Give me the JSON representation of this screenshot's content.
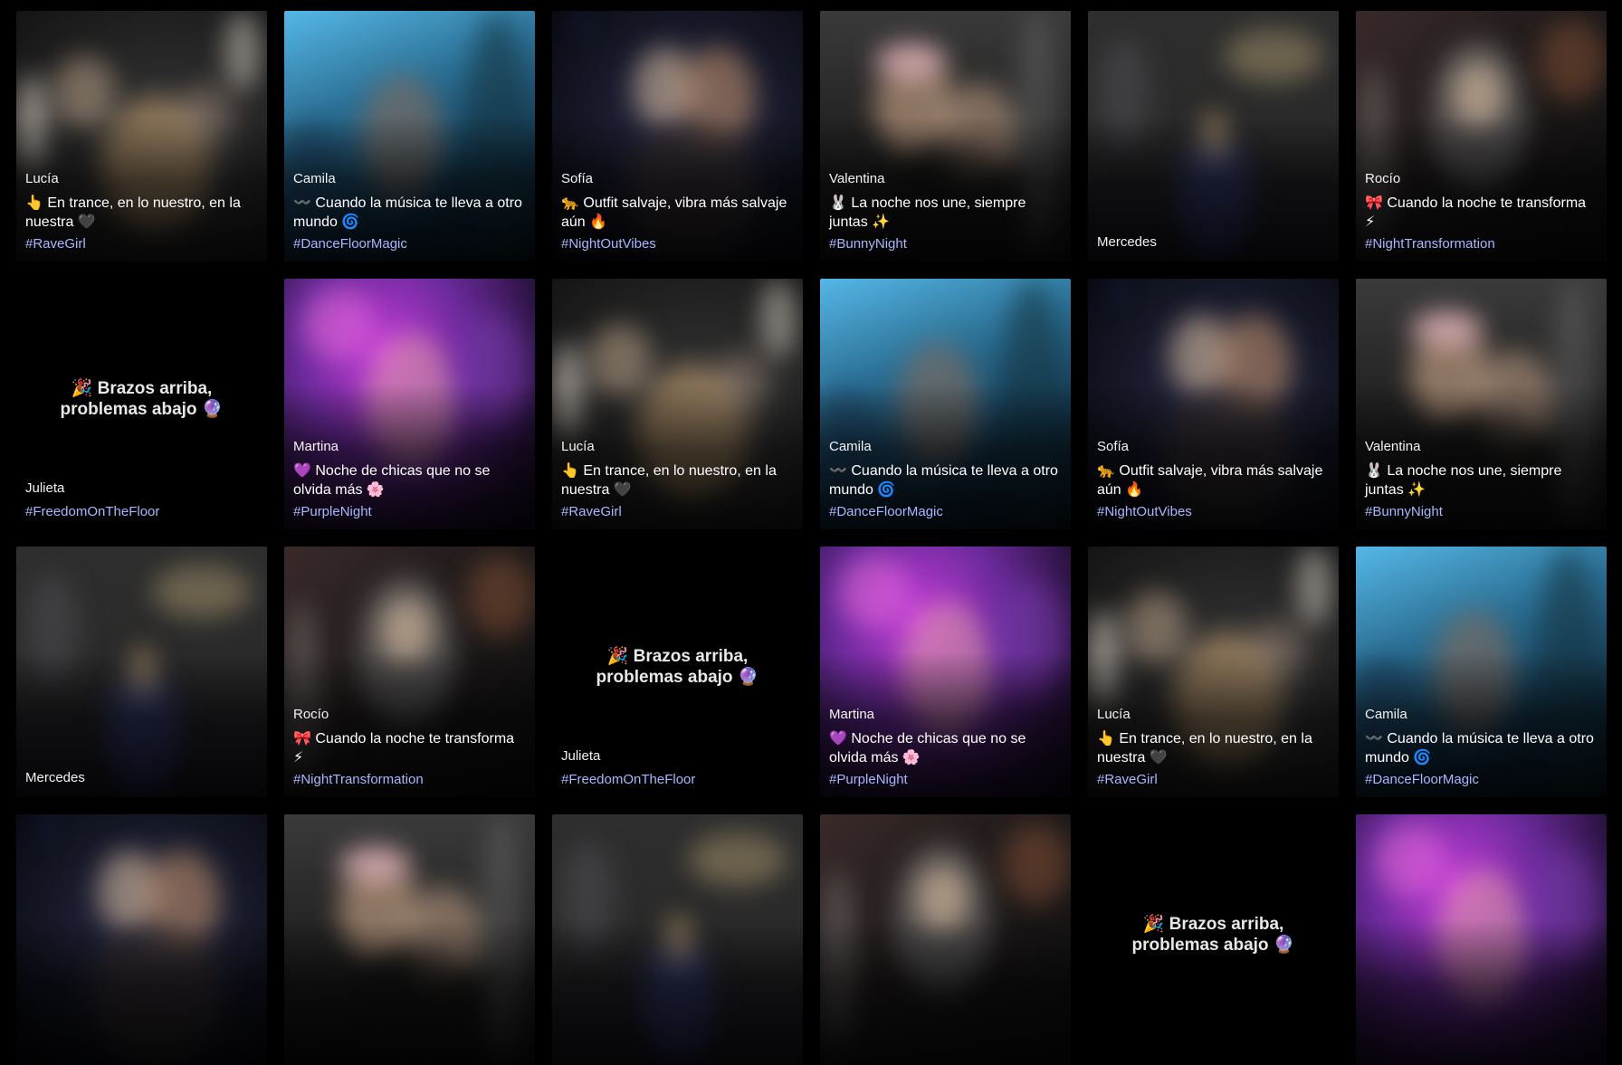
{
  "colors": {
    "background": "#000000",
    "hashtag": "#a9b7ff",
    "text": "#ffffff"
  },
  "cards": [
    {
      "kind": "photo",
      "theme": "crowd",
      "author": "Lucía",
      "caption": "👆 En trance, en lo nuestro, en la nuestra 🖤",
      "tag": "#RaveGirl"
    },
    {
      "kind": "photo",
      "theme": "blue",
      "author": "Camila",
      "caption": "〰️ Cuando la música te lleva a otro mundo 🌀",
      "tag": "#DanceFloorMagic"
    },
    {
      "kind": "photo",
      "theme": "duo",
      "author": "Sofía",
      "caption": "🐆 Outfit salvaje, vibra más salvaje aún 🔥",
      "tag": "#NightOutVibes"
    },
    {
      "kind": "photo",
      "theme": "bunny",
      "author": "Valentina",
      "caption": "🐰 La noche nos une, siempre juntas ✨",
      "tag": "#BunnyNight"
    },
    {
      "kind": "photo",
      "theme": "castle",
      "author": "Mercedes",
      "caption": "",
      "tag": ""
    },
    {
      "kind": "photo",
      "theme": "bar",
      "author": "Rocío",
      "caption": "🎀 Cuando la noche te transforma ⚡",
      "tag": "#NightTransformation"
    },
    {
      "kind": "text",
      "theme": "none",
      "headline": "🎉 Brazos arriba, problemas abajo 🔮",
      "author": "Julieta",
      "caption": "",
      "tag": "#FreedomOnTheFloor"
    },
    {
      "kind": "photo",
      "theme": "purple",
      "author": "Martina",
      "caption": "💜 Noche de chicas que no se olvida más 🌸",
      "tag": "#PurpleNight"
    },
    {
      "kind": "photo",
      "theme": "crowd",
      "author": "Lucía",
      "caption": "👆 En trance, en lo nuestro, en la nuestra 🖤",
      "tag": "#RaveGirl"
    },
    {
      "kind": "photo",
      "theme": "blue",
      "author": "Camila",
      "caption": "〰️ Cuando la música te lleva a otro mundo 🌀",
      "tag": "#DanceFloorMagic"
    },
    {
      "kind": "photo",
      "theme": "duo",
      "author": "Sofía",
      "caption": "🐆 Outfit salvaje, vibra más salvaje aún 🔥",
      "tag": "#NightOutVibes"
    },
    {
      "kind": "photo",
      "theme": "bunny",
      "author": "Valentina",
      "caption": "🐰 La noche nos une, siempre juntas ✨",
      "tag": "#BunnyNight"
    },
    {
      "kind": "photo",
      "theme": "castle",
      "author": "Mercedes",
      "caption": "",
      "tag": ""
    },
    {
      "kind": "photo",
      "theme": "bar",
      "author": "Rocío",
      "caption": "🎀 Cuando la noche te transforma ⚡",
      "tag": "#NightTransformation"
    },
    {
      "kind": "text",
      "theme": "none",
      "headline": "🎉 Brazos arriba, problemas abajo 🔮",
      "author": "Julieta",
      "caption": "",
      "tag": "#FreedomOnTheFloor"
    },
    {
      "kind": "photo",
      "theme": "purple",
      "author": "Martina",
      "caption": "💜 Noche de chicas que no se olvida más 🌸",
      "tag": "#PurpleNight"
    },
    {
      "kind": "photo",
      "theme": "crowd",
      "author": "Lucía",
      "caption": "👆 En trance, en lo nuestro, en la nuestra 🖤",
      "tag": "#RaveGirl"
    },
    {
      "kind": "photo",
      "theme": "blue",
      "author": "Camila",
      "caption": "〰️ Cuando la música te lleva a otro mundo 🌀",
      "tag": "#DanceFloorMagic"
    },
    {
      "kind": "photo",
      "theme": "duo",
      "author": "",
      "caption": "",
      "tag": ""
    },
    {
      "kind": "photo",
      "theme": "bunny",
      "author": "",
      "caption": "",
      "tag": ""
    },
    {
      "kind": "photo",
      "theme": "castle",
      "author": "",
      "caption": "",
      "tag": ""
    },
    {
      "kind": "photo",
      "theme": "bar",
      "author": "",
      "caption": "",
      "tag": ""
    },
    {
      "kind": "text",
      "theme": "none",
      "headline": "🎉 Brazos arriba, problemas abajo 🔮",
      "author": "",
      "caption": "",
      "tag": ""
    },
    {
      "kind": "photo",
      "theme": "purple",
      "author": "",
      "caption": "",
      "tag": ""
    }
  ]
}
